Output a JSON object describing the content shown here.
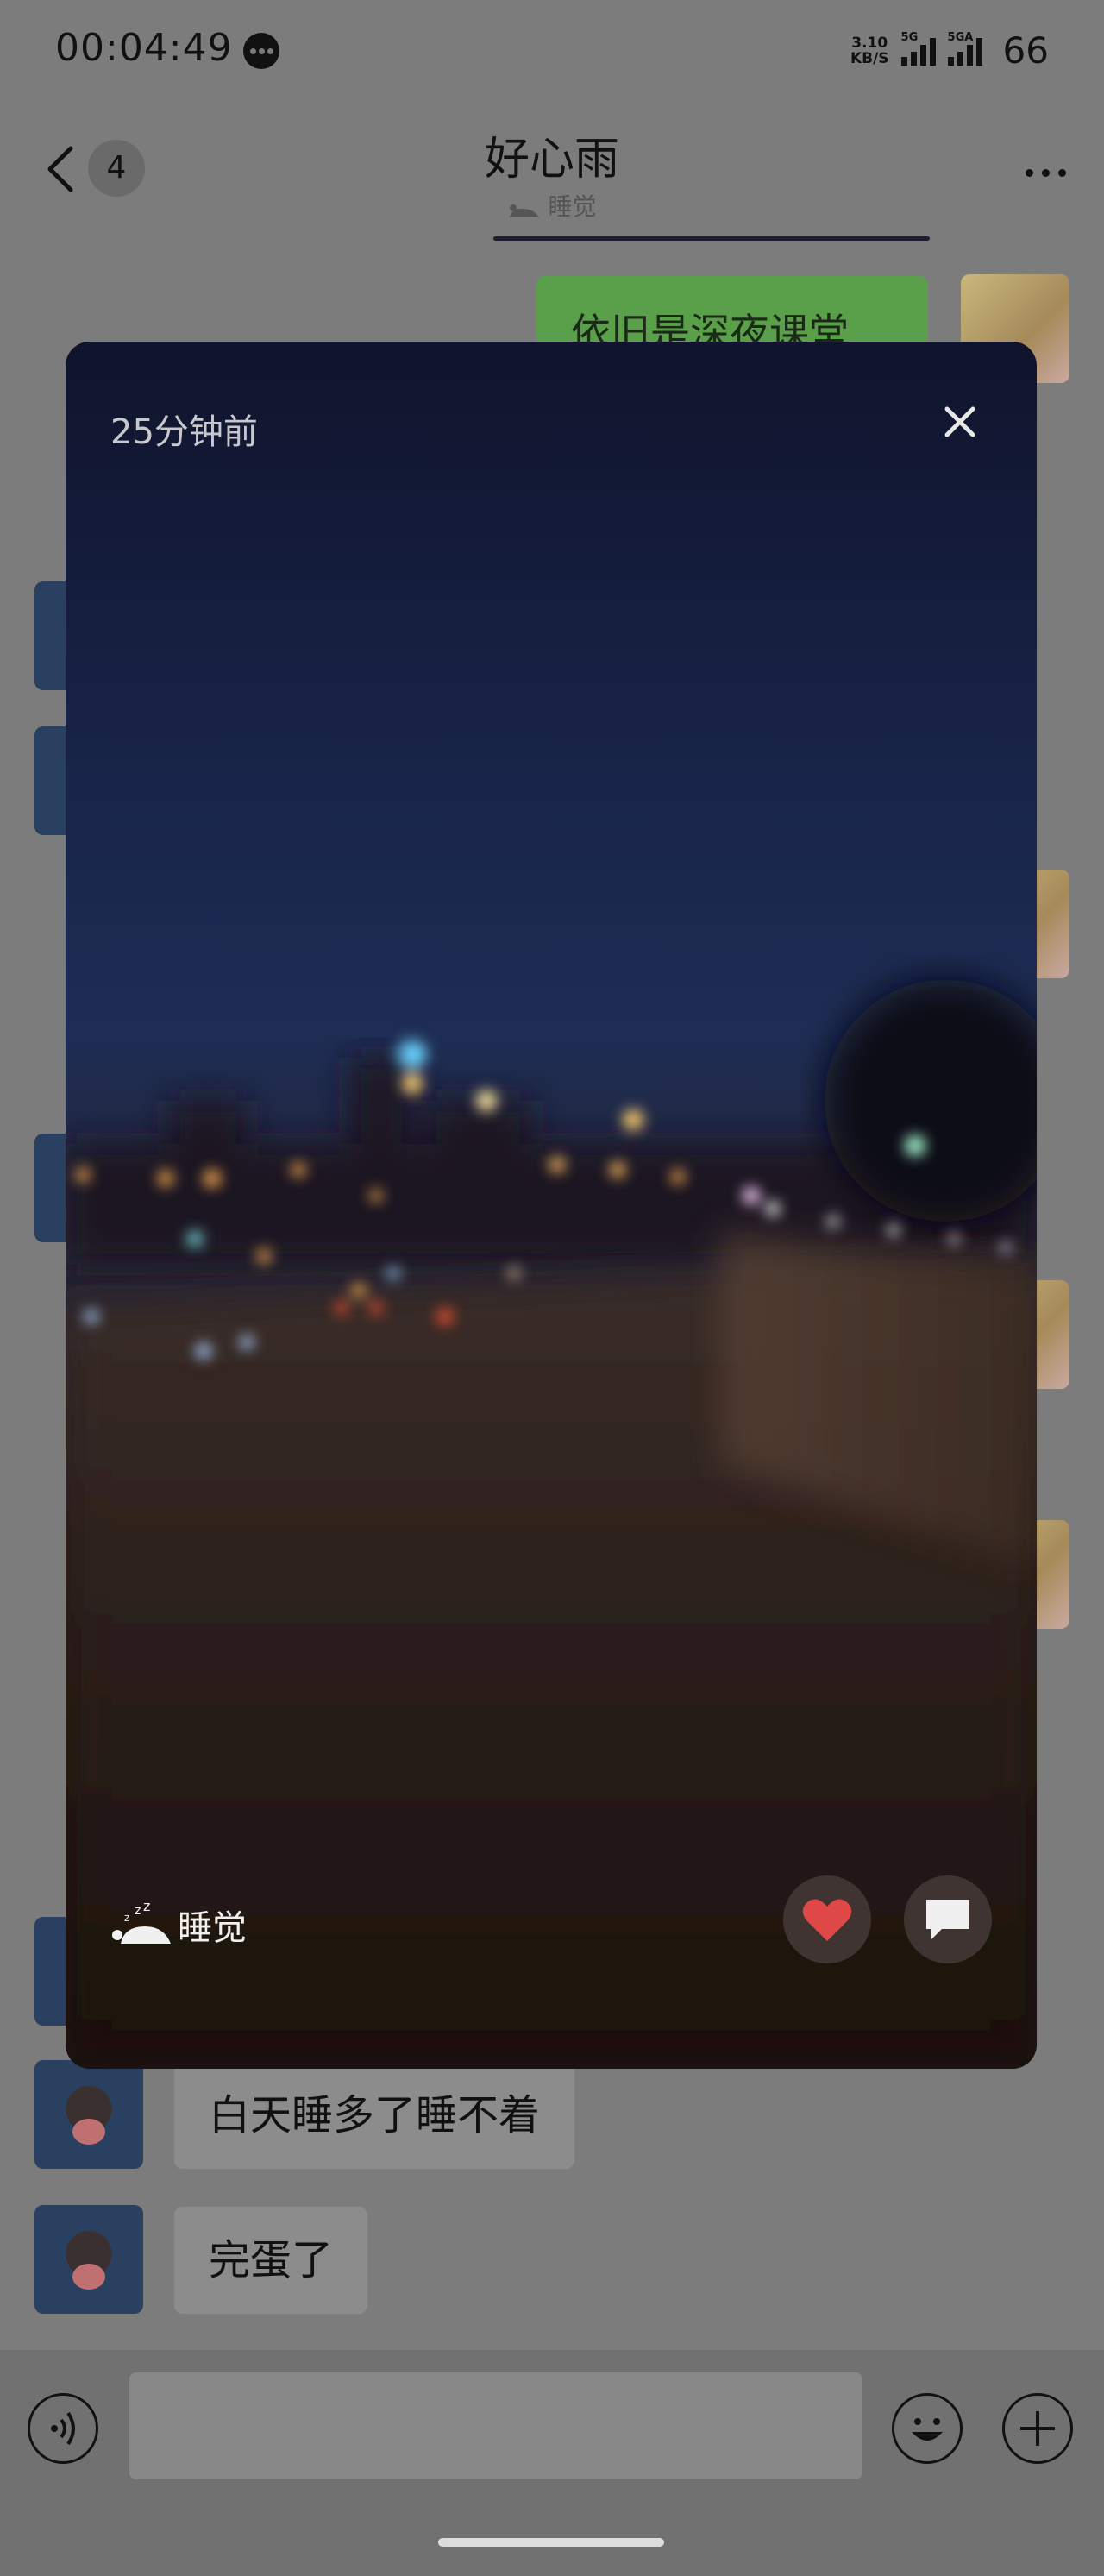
{
  "status_bar": {
    "time": "00:04:49",
    "net_speed_top": "3.10",
    "net_speed_bottom": "KB/S",
    "signal_1_tag": "5G",
    "signal_2_tag": "5GA",
    "battery": "66"
  },
  "header": {
    "unread_count": "4",
    "title": "好心雨",
    "subtitle": "睡觉"
  },
  "messages": [
    {
      "side": "right",
      "text": "依旧是深夜课堂"
    },
    {
      "side": "left",
      "text": "白天睡多了睡不着"
    },
    {
      "side": "left",
      "text": "完蛋了"
    }
  ],
  "status_card": {
    "time_ago": "25分钟前",
    "status_text": "睡觉",
    "colors": {
      "like": "#e04848",
      "overlay_bg": "#403432"
    }
  },
  "icons": {
    "back": "chevron-left-icon",
    "more": "more-dots-icon",
    "close": "close-icon",
    "sleep": "sleep-icon",
    "like": "heart-icon",
    "comment": "comment-icon",
    "voice": "voice-icon",
    "emoji": "emoji-icon",
    "plus": "plus-icon"
  }
}
